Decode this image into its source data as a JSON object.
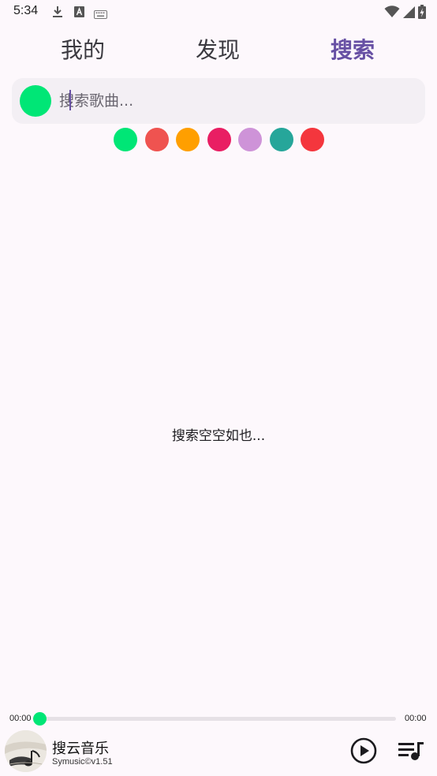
{
  "status_bar": {
    "time": "5:34",
    "left_icons": [
      "download-icon",
      "font-a-icon",
      "keyboard-icon"
    ],
    "right_icons": [
      "wifi-icon",
      "signal-icon",
      "battery-charging-icon"
    ]
  },
  "tabs": [
    {
      "label": "我的",
      "active": false
    },
    {
      "label": "发现",
      "active": false
    },
    {
      "label": "搜索",
      "active": true
    }
  ],
  "search": {
    "placeholder": "搜索歌曲...",
    "value": "",
    "color_dot": "#00e676"
  },
  "color_swatches": [
    "#00e676",
    "#ef5350",
    "#ff9f00",
    "#e91e63",
    "#ce93d8",
    "#26a69a",
    "#f4363d"
  ],
  "empty_state": "搜索空空如也...",
  "player": {
    "current_time": "00:00",
    "total_time": "00:00",
    "progress": 0,
    "title": "搜云音乐",
    "subtitle": "Symusic©v1.51"
  },
  "colors": {
    "accent": "#6750a4",
    "background": "#fdf8fc",
    "progress": "#00e676"
  }
}
